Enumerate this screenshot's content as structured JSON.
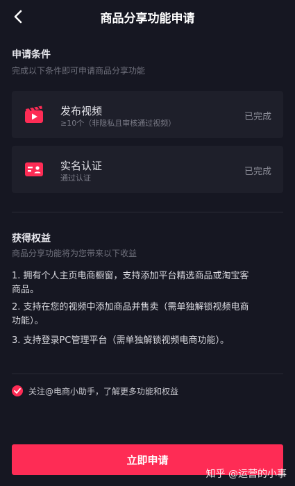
{
  "header": {
    "title": "商品分享功能申请",
    "back_icon": "chevron-left-icon"
  },
  "conditions": {
    "title": "申请条件",
    "subtitle": "完成以下条件即可申请商品分享功能",
    "items": [
      {
        "icon": "video-clapper-icon",
        "title": "发布视频",
        "subtitle": "≥10个（非隐私且审核通过视频）",
        "status": "已完成"
      },
      {
        "icon": "id-card-icon",
        "title": "实名认证",
        "subtitle": "通过认证",
        "status": "已完成"
      }
    ]
  },
  "benefits": {
    "title": "获得权益",
    "subtitle": "商品分享功能将为您带来以下收益",
    "items": [
      {
        "line1": "1. 拥有个人主页电商橱窗，支持添加平台精选商品或淘宝客",
        "line2": "商品。"
      },
      {
        "line1": "2. 支持在您的视频中添加商品并售卖（需单独解锁视频电商",
        "line2": "功能）。"
      },
      {
        "line1": "3. 支持登录PC管理平台（需单独解锁视频电商功能）。",
        "line2": ""
      }
    ]
  },
  "agreement": {
    "text": "关注@电商小助手，了解更多功能和权益",
    "checked": true
  },
  "apply_button": {
    "label": "立即申请"
  },
  "watermark": {
    "text": "知乎 @运营的小事"
  },
  "colors": {
    "background": "#161722",
    "card": "#1e1f2a",
    "accent": "#fe2c55"
  }
}
